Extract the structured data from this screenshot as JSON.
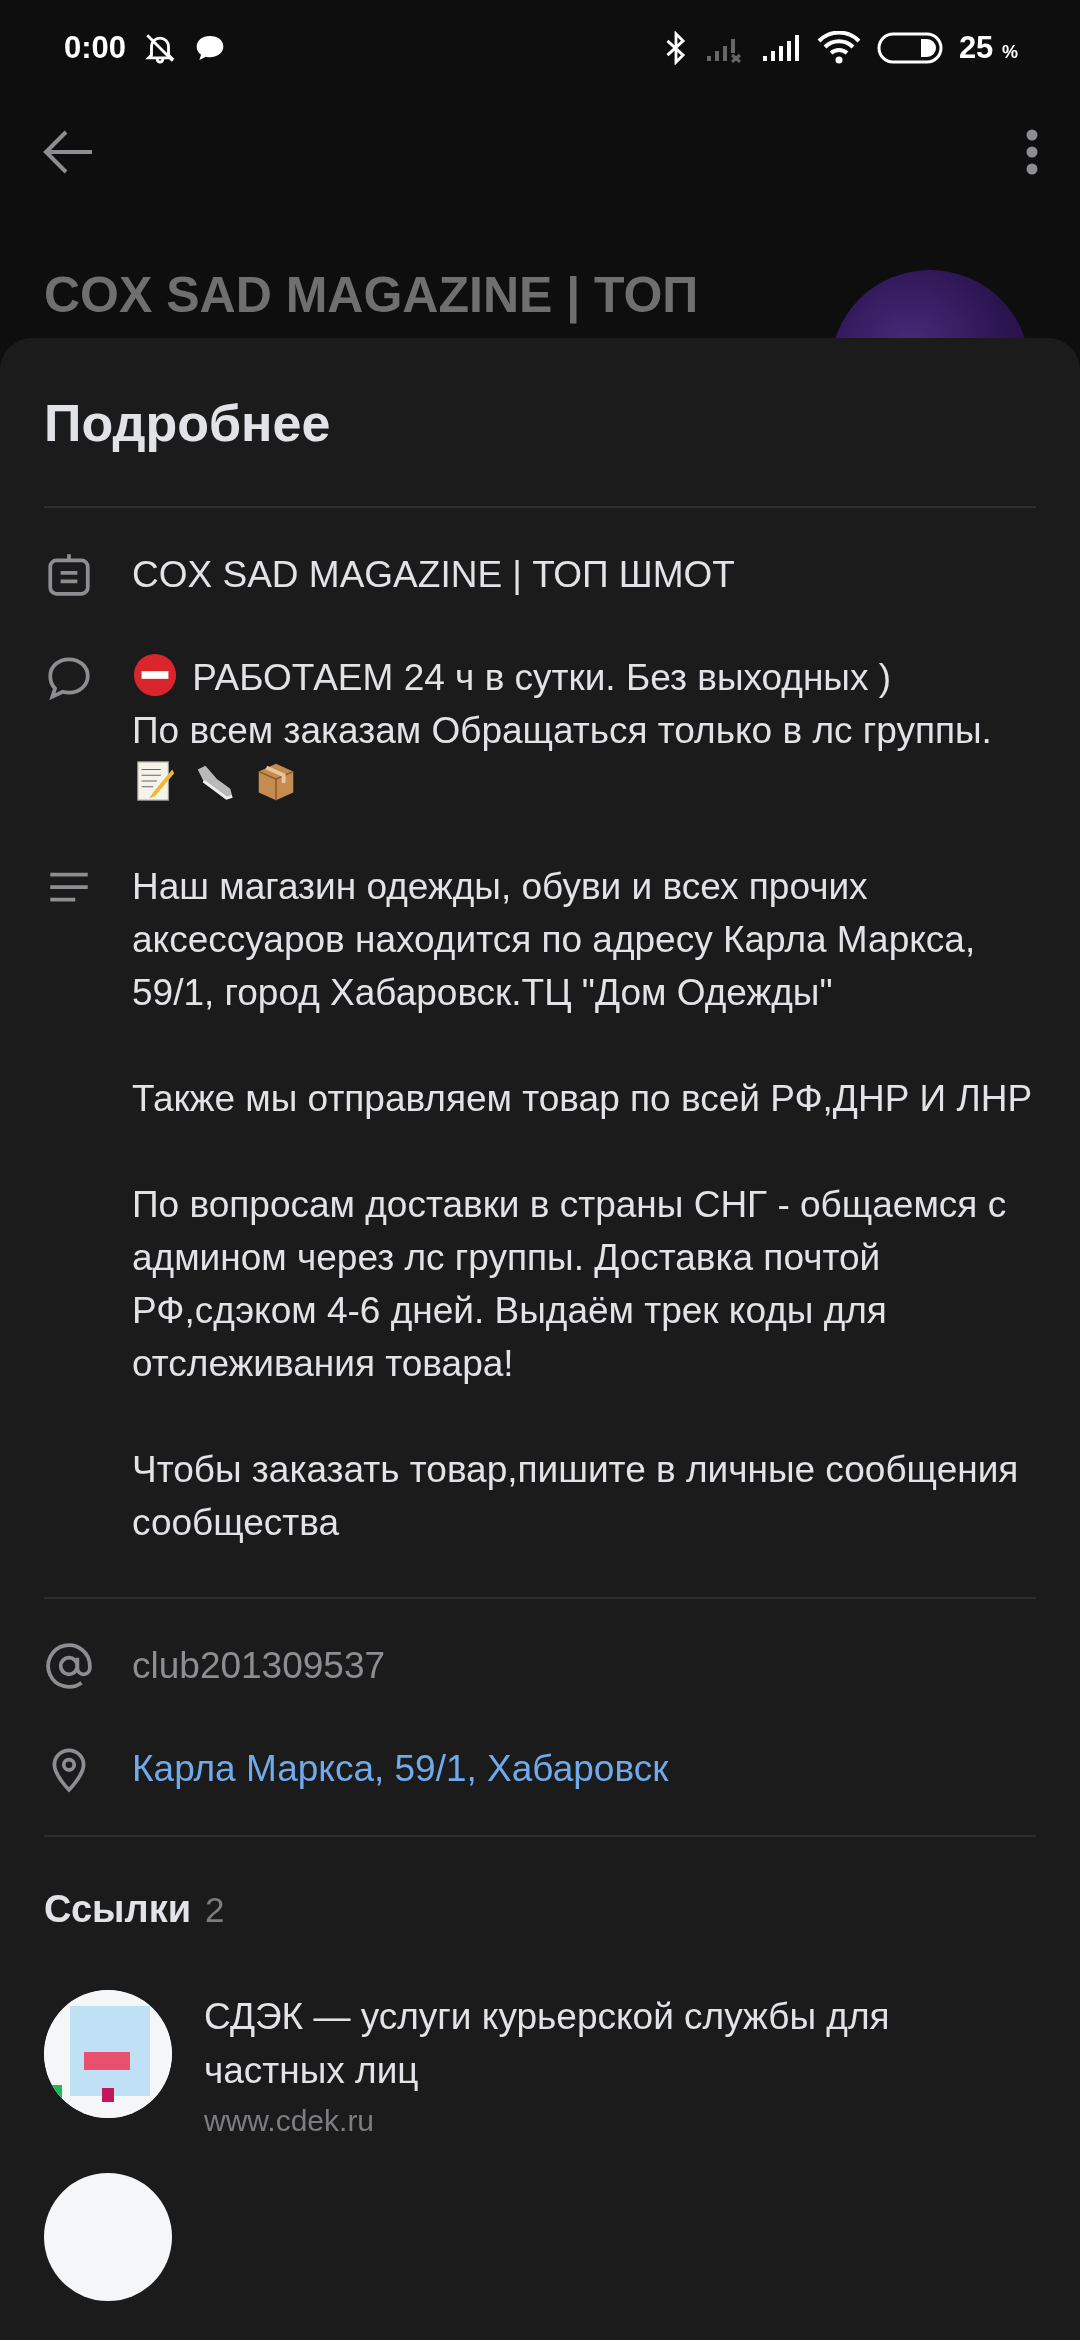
{
  "status_bar": {
    "time": "0:00",
    "battery": "25",
    "battery_unit": "%"
  },
  "header": {
    "group_title": "COX SAD MAGAZINE | ТОП"
  },
  "sheet": {
    "title": "Подробнее",
    "name_row": {
      "text": "COX SAD MAGAZINE | ТОП ШМОТ"
    },
    "status_row": {
      "lines": [
        [
          {
            "kind": "no-entry"
          },
          {
            "kind": "text",
            "text": "РАБОТАЕМ 24 ч в сутки. Без выходных )"
          }
        ],
        [
          {
            "kind": "text",
            "text": "По всем заказам Обращаться только в лс группы."
          },
          {
            "kind": "memo"
          },
          {
            "kind": "shoe"
          },
          {
            "kind": "package"
          }
        ]
      ]
    },
    "description": [
      "Наш магазин одежды, обуви и всех прочих аксессуаров находится по адресу Карла Маркса, 59/1, город Хабаровск.ТЦ \"Дом Одежды\"",
      "Также мы отправляем товар по всей РФ,ДНР И ЛНР",
      "По вопросам доставки в страны СНГ - общаемся с админом через лс группы. Доставка почтой РФ,сдэком 4-6 дней. Выдаём трек коды для отслеживания товара!",
      "Чтобы заказать товар,пишите в личные сообщения сообщества"
    ],
    "short_address": "club201309537",
    "address": "Карла Маркса, 59/1, Хабаровск",
    "links_section": {
      "title": "Ссылки",
      "count": "2",
      "links": [
        {
          "title": "СДЭК — услуги курьерской службы для частных лиц",
          "url": "www.cdek.ru"
        }
      ]
    }
  }
}
